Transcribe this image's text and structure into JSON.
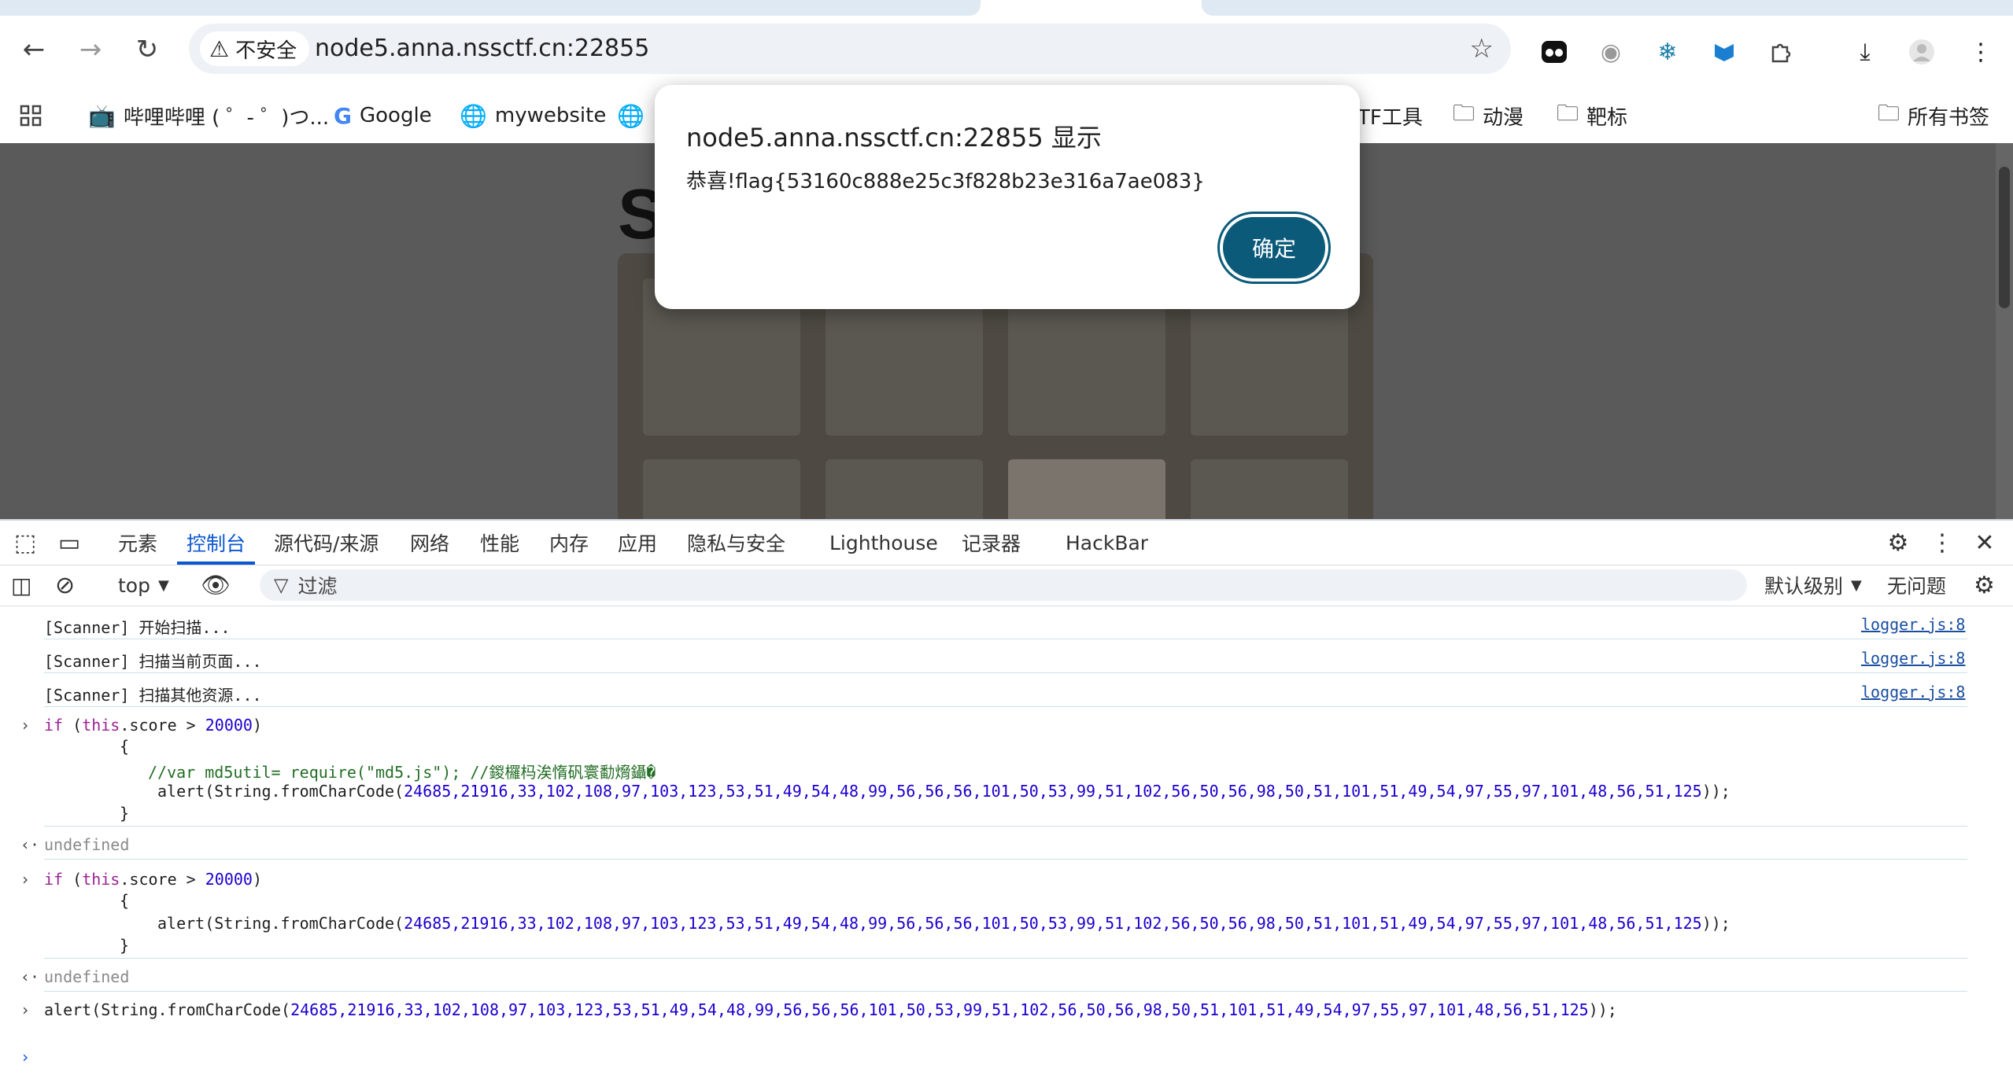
{
  "browser": {
    "security_label": "不安全",
    "url": "node5.anna.nssctf.cn:22855",
    "bookmarks": [
      {
        "label": "哔哩哔哩 ( ゜- ゜)つ..."
      },
      {
        "label": "Google"
      },
      {
        "label": "mywebsite"
      },
      {
        "label": "TF工具"
      },
      {
        "label": "动漫"
      },
      {
        "label": "靶标"
      },
      {
        "label": "所有书签"
      }
    ]
  },
  "page": {
    "title_partial": "S"
  },
  "dialog": {
    "title": "node5.anna.nssctf.cn:22855 显示",
    "message": "恭喜!flag{53160c888e25c3f828b23e316a7ae083}",
    "ok_label": "确定"
  },
  "devtools": {
    "tabs": [
      "元素",
      "控制台",
      "源代码/来源",
      "网络",
      "性能",
      "内存",
      "应用",
      "隐私与安全",
      "Lighthouse",
      "记录器",
      "HackBar"
    ],
    "active_tab": "控制台",
    "context": "top",
    "filter_placeholder": "过滤",
    "level": "默认级别",
    "issues": "无问题"
  },
  "console": {
    "logs": [
      {
        "text": "[Scanner] 开始扫描...",
        "source": "logger.js:8"
      },
      {
        "text": "[Scanner] 扫描当前页面...",
        "source": "logger.js:8"
      },
      {
        "text": "[Scanner] 扫描其他资源...",
        "source": "logger.js:8"
      }
    ],
    "input1": {
      "line1_kw": "if",
      "line1_open": " (",
      "line1_this": "this",
      "line1_rest": ".score > ",
      "line1_num": "20000",
      "line1_close": ")",
      "brace_open": "{",
      "comment": "//var md5util= require(\"md5.js\"); //鍐欏杩涘惰矾寰勫熁鑷�",
      "alert_prefix": "alert(String.fromCharCode(",
      "alert_args": "24685,21916,33,102,108,97,103,123,53,51,49,54,48,99,56,56,56,101,50,53,99,51,102,56,50,56,98,50,51,101,51,49,54,97,55,97,101,48,56,51,125",
      "alert_suffix": "));",
      "brace_close": "}"
    },
    "result1": "undefined",
    "result2": "undefined"
  }
}
